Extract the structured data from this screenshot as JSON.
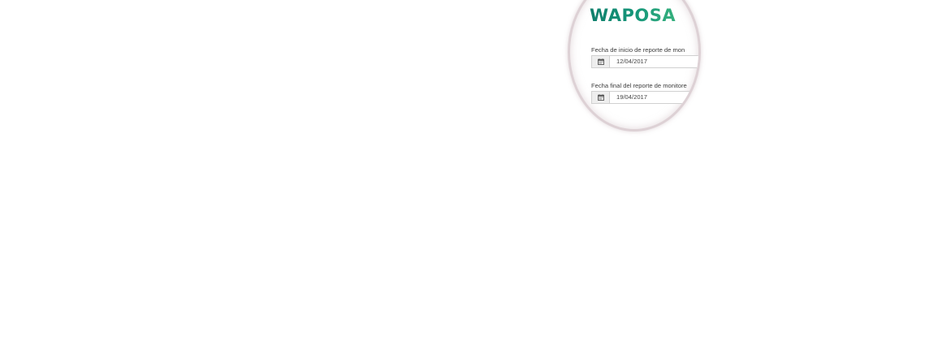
{
  "brand": {
    "logo_text": "WAPOSA",
    "colors": {
      "logo_start": "#0f7f6c",
      "logo_end": "#36b07d",
      "magnifier_border": "#ddd1d5"
    }
  },
  "form": {
    "start_date": {
      "label": "Fecha de inicio de reporte de mon",
      "value": "12/04/2017",
      "icon": "calendar-icon"
    },
    "end_date": {
      "label": "Fecha final del reporte de monitore",
      "value": "19/04/2017",
      "icon": "calendar-icon"
    }
  }
}
